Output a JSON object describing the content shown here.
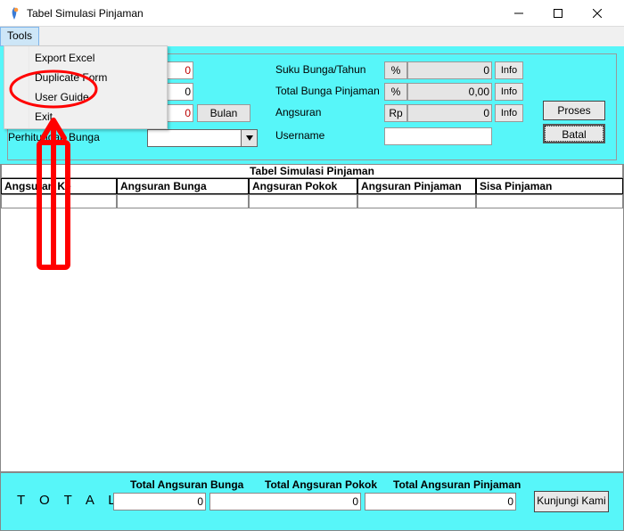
{
  "window": {
    "title": "Tabel Simulasi Pinjaman"
  },
  "menu": {
    "tools": "Tools"
  },
  "dropdown": {
    "export": "Export Excel",
    "duplicate": "Duplicate Form",
    "user_guide": "User Guide",
    "exit": "Exit"
  },
  "form": {
    "pinjaman_value": "0",
    "field2_value": "0",
    "jangka_value": "0",
    "jangka_unit": "Bulan",
    "perhitungan_label": "Perhitungan Bunga",
    "suku_label": "Suku Bunga/Tahun",
    "total_bunga_label": "Total Bunga Pinjaman",
    "angsuran_label": "Angsuran",
    "username_label": "Username",
    "pct": "%",
    "rp": "Rp",
    "suku_value": "0",
    "total_bunga_value": "0,00",
    "angsuran_value": "0",
    "info": "Info",
    "proses": "Proses",
    "batal": "Batal"
  },
  "table": {
    "title": "Tabel Simulasi Pinjaman",
    "headers": {
      "c0": "Angsuran Ke",
      "c1": "Angsuran Bunga",
      "c2": "Angsuran Pokok",
      "c3": "Angsuran Pinjaman",
      "c4": "Sisa Pinjaman"
    }
  },
  "footer": {
    "total": "T O T A L",
    "h1": "Total Angsuran Bunga",
    "h2": "Total Angsuran Pokok",
    "h3": "Total Angsuran Pinjaman",
    "v1": "0",
    "v2": "0",
    "v3": "0",
    "kunjungi": "Kunjungi Kami"
  }
}
